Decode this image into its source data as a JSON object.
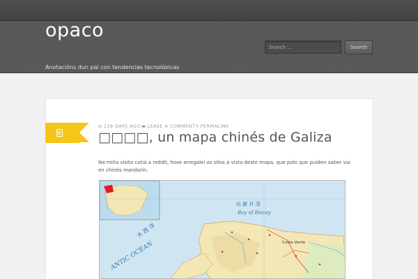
{
  "site": {
    "title": "opaco",
    "description": "Anotacións dun pai con tendencias tecnolóxicas"
  },
  "search": {
    "placeholder": "Search ...",
    "button_label": "Search"
  },
  "post": {
    "meta": {
      "date": "218 DAYS AGO",
      "comment": "LEAVE A COMMENT",
      "permalink": "PERMALINK"
    },
    "title": "□□□□, un mapa chinés de Galiza",
    "text": "Na miña visita cotiá a reddit, hoxe arregalei os ollos á vista deste mapa, que polo que puiden saber vai en chinés mandarín.",
    "map_labels": {
      "bay": "Bay   of   Biscay",
      "ocean": "ANTIC  OCEAN",
      "cn_top": "比  斯  开  湾",
      "cn_ocean": "大  西  洋",
      "costa": "Costa Verde"
    }
  },
  "colors": {
    "accent_flag": "#f5c518",
    "header_bg": "#56585a",
    "topbar_bg": "#4a4c4e",
    "sea": "#cfe6f2",
    "land": "#f3e7b6",
    "highlight": "#e31b23"
  },
  "icons": {
    "date": "clock-icon",
    "comment": "comment-icon",
    "permalink": "bolt-icon",
    "format": "document-icon"
  }
}
